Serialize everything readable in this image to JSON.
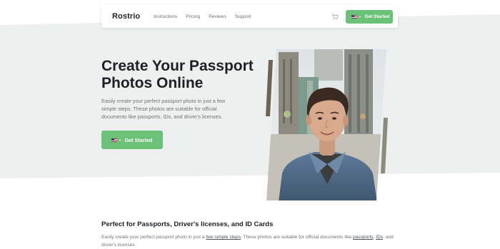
{
  "colors": {
    "accent": "#6ac178",
    "band": "#eef0ef",
    "text_dark": "#1d2125",
    "text_muted": "#6d7377"
  },
  "nav": {
    "brand": "Rostrio",
    "links": [
      "Instructions",
      "Pricing",
      "Reviews",
      "Support"
    ],
    "cart_icon": "cart-icon",
    "cta_label": "Get Started",
    "flag_icon": "us-flag-icon"
  },
  "hero": {
    "title": "Create Your Passport Photos Online",
    "description": "Easily create your perfect passport photo in just a few simple steps. These photos are suitable for official documents like passports, IDs, and driver's licenses.",
    "cta_label": "Get Started",
    "image_icon": "portrait-photo"
  },
  "section": {
    "title": "Perfect for Passports, Driver's licenses, and ID Cards",
    "desc_parts": {
      "p1": "Easily create your perfect passport photo in just a ",
      "link1": "few simple steps",
      "p2": ". These photos are suitable for official documents like ",
      "link2": "passports",
      "p3": ", ",
      "link3": "IDs",
      "p4": ", and driver's licenses."
    }
  }
}
